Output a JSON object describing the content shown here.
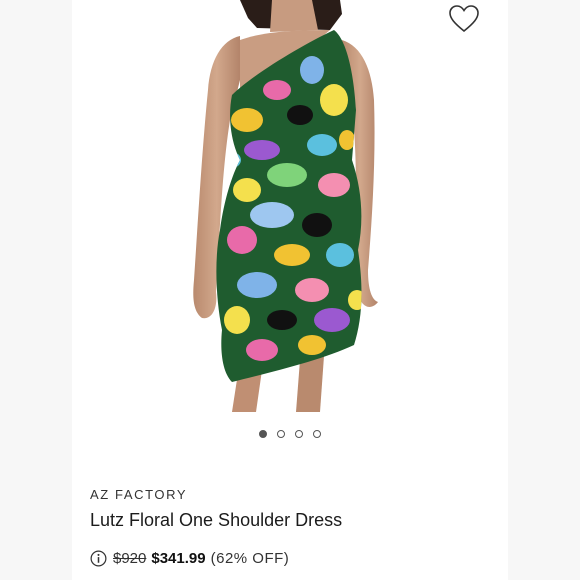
{
  "product": {
    "brand": "AZ FACTORY",
    "title": "Lutz Floral One Shoulder Dress",
    "original_price": "$920",
    "sale_price": "$341.99",
    "discount": "(62% OFF)"
  },
  "carousel": {
    "total_images": 4,
    "active_index": 0
  },
  "icons": {
    "wishlist": "heart-outline-icon",
    "price_info": "info-circle-icon"
  },
  "colors": {
    "background": "#f7f7f7",
    "card": "#ffffff",
    "text": "#1c1c1c"
  }
}
